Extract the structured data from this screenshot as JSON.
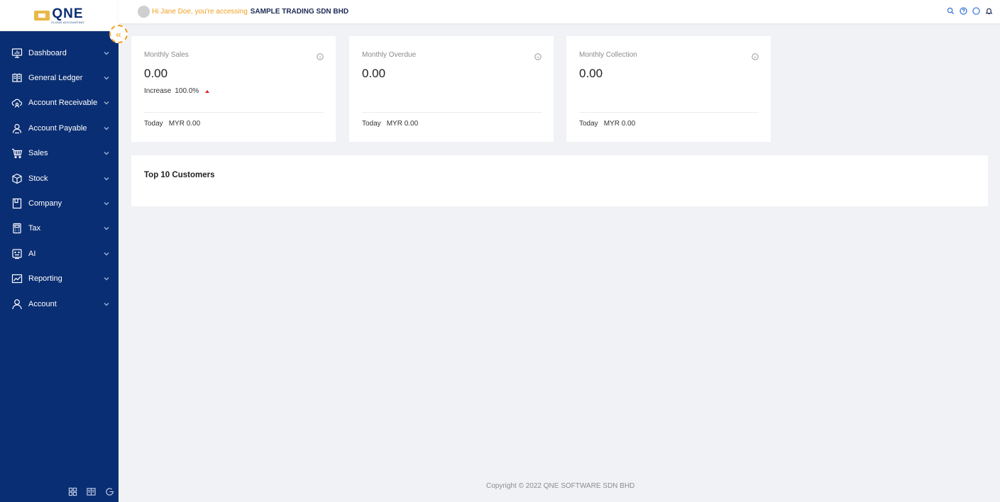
{
  "brand": {
    "logo_word": "QNE",
    "logo_sub": "CLOUD ACCOUNTING"
  },
  "header": {
    "greeting": "Hi Jane Doe, you're accessing",
    "company": "SAMPLE TRADING SDN BHD",
    "icons": [
      "search-icon",
      "help-icon",
      "chat-icon",
      "bell-icon"
    ],
    "accent": "#f0a020"
  },
  "sidebar": {
    "background": "#0a2e73",
    "items": [
      {
        "label": "Dashboard",
        "icon": "monitor-chart-icon"
      },
      {
        "label": "General Ledger",
        "icon": "ledger-icon"
      },
      {
        "label": "Account Receivable",
        "icon": "cloud-user-icon"
      },
      {
        "label": "Account Payable",
        "icon": "user-icon"
      },
      {
        "label": "Sales",
        "icon": "cart-icon"
      },
      {
        "label": "Stock",
        "icon": "box-icon"
      },
      {
        "label": "Company",
        "icon": "document-icon"
      },
      {
        "label": "Tax",
        "icon": "calculator-icon"
      },
      {
        "label": "AI",
        "icon": "robot-icon"
      },
      {
        "label": "Reporting",
        "icon": "line-chart-icon"
      },
      {
        "label": "Account",
        "icon": "person-icon"
      }
    ],
    "footer_icons": [
      "grid-icon",
      "book-icon",
      "logout-icon"
    ]
  },
  "kpis": [
    {
      "title": "Monthly Sales",
      "value": "0.00",
      "change_label": "Increase",
      "change_value": "100.0%",
      "today_label": "Today",
      "today_value": "MYR 0.00"
    },
    {
      "title": "Monthly Overdue",
      "value": "0.00",
      "today_label": "Today",
      "today_value": "MYR 0.00"
    },
    {
      "title": "Monthly Collection",
      "value": "0.00",
      "today_label": "Today",
      "today_value": "MYR 0.00"
    }
  ],
  "top_customers": {
    "title": "Top 10 Customers"
  },
  "footer": {
    "copyright": "Copyright © 2022 QNE SOFTWARE SDN BHD"
  }
}
